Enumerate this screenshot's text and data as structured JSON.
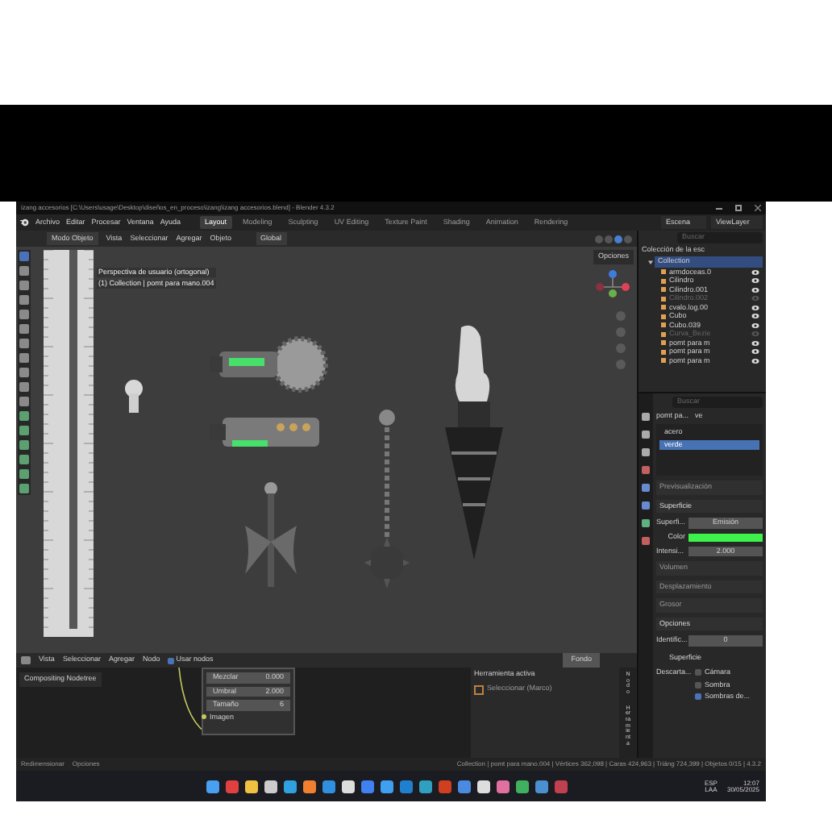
{
  "window": {
    "title": "izang accesorios [C:\\Users\\usage\\Desktop\\diseños_en_proceso\\izang\\izang accesorios.blend] - Blender 4.3.2"
  },
  "menu": [
    "Archivo",
    "Editar",
    "Procesar",
    "Ventana",
    "Ayuda"
  ],
  "workspaces": [
    {
      "label": "Layout",
      "selected": true
    },
    {
      "label": "Modeling",
      "selected": false
    },
    {
      "label": "Sculpting",
      "selected": false
    },
    {
      "label": "UV Editing",
      "selected": false
    },
    {
      "label": "Texture Paint",
      "selected": false
    },
    {
      "label": "Shading",
      "selected": false
    },
    {
      "label": "Animation",
      "selected": false
    },
    {
      "label": "Rendering",
      "selected": false
    }
  ],
  "scene": "Escena",
  "view_layer": "ViewLayer",
  "viewport": {
    "mode": "Modo Objeto",
    "menus": [
      "Vista",
      "Seleccionar",
      "Agregar",
      "Objeto"
    ],
    "orientation": "Global",
    "options": "Opciones",
    "overlay_lines": [
      "Perspectiva de usuario (ortogonal)",
      "(1) Collection | pomt para mano.004"
    ]
  },
  "outliner": {
    "search": "Buscar",
    "root": "Colección de la esc",
    "collection": {
      "label": "Collection",
      "expanded": true,
      "selected": true,
      "children": [
        {
          "label": "armdoceas.0",
          "visible": true,
          "selected": false
        },
        {
          "label": "Cilindro",
          "visible": true,
          "selected": false
        },
        {
          "label": "Cilindro.001",
          "visible": true,
          "selected": false
        },
        {
          "label": "Cilindro.002",
          "visible": false,
          "selected": false
        },
        {
          "label": "cvalo.log.00",
          "visible": true,
          "selected": false
        },
        {
          "label": "Cubo",
          "visible": true,
          "selected": false
        },
        {
          "label": "Cubo.039",
          "visible": true,
          "selected": false
        },
        {
          "label": "Curva_Bezie",
          "visible": false,
          "selected": false
        },
        {
          "label": "pomt para m",
          "visible": true,
          "selected": false
        },
        {
          "label": "pomt para m",
          "visible": true,
          "selected": false
        },
        {
          "label": "pomt para m",
          "visible": true,
          "selected": false
        }
      ]
    }
  },
  "properties": {
    "search": "Buscar",
    "material": "pomt pa...",
    "material_short": "ve",
    "slots": [
      {
        "label": "acero",
        "selected": false
      },
      {
        "label": "verde",
        "selected": true
      }
    ],
    "rows": [
      {
        "kind": "header",
        "label": "Previsualización",
        "expanded": false
      },
      {
        "kind": "header",
        "label": "Superficie",
        "expanded": true
      },
      {
        "kind": "field",
        "label": "Superfi...",
        "value": "Emisión"
      },
      {
        "kind": "color",
        "label": "Color",
        "color": "#3df24a"
      },
      {
        "kind": "field",
        "label": "Intensi...",
        "value": "2.000"
      },
      {
        "kind": "header",
        "label": "Volumen",
        "expanded": false
      },
      {
        "kind": "header",
        "label": "Desplazamiento",
        "expanded": false
      },
      {
        "kind": "header",
        "label": "Grosor",
        "expanded": false
      },
      {
        "kind": "header",
        "label": "Opciones",
        "expanded": true
      },
      {
        "kind": "field",
        "label": "Identific...",
        "value": "0"
      },
      {
        "kind": "sub",
        "label": "Superficie",
        "expanded": true
      },
      {
        "kind": "check",
        "label": "Descarta...",
        "text": "Cámara",
        "checked": false
      },
      {
        "kind": "check",
        "text": "Sombra",
        "checked": false
      },
      {
        "kind": "check",
        "text": "Sombras de...",
        "checked": true
      }
    ]
  },
  "node_editor": {
    "menus": [
      "Vista",
      "Seleccionar",
      "Agregar",
      "Nodo"
    ],
    "use_nodes": {
      "label": "Usar nodos",
      "checked": true
    },
    "background": "Fondo",
    "breadcrumb": "Compositing Nodetree",
    "node_fields": [
      {
        "label": "Mezclar",
        "value": "0.000"
      },
      {
        "label": "Umbral",
        "value": "2.000"
      },
      {
        "label": "Tamaño",
        "value": "6"
      }
    ],
    "socket": "Imagen",
    "panel_title": "Herramienta activa",
    "tool": "Seleccionar (Marco)",
    "side_tabs": [
      "Nodo",
      "Herramienta"
    ]
  },
  "status": {
    "left": [
      "Redimensionar",
      "Opciones"
    ],
    "right": "Collection | pomt para mano.004 | Vértices 362,098 | Caras 424,963 | Triáng 724,399 | Objetos 0/15 | 4.3.2"
  },
  "taskbar": {
    "language": "ESP",
    "layout": "LAA",
    "time": "12:07",
    "date": "30/05/2025"
  }
}
